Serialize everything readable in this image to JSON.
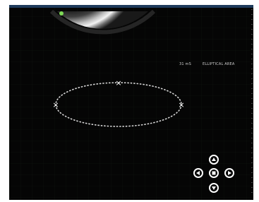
{
  "viewer": {
    "background_color": "#050505",
    "top_bar_color": "#1f3b5c",
    "grid_color": "#2b3a2b",
    "probe_indicator_color": "#7ed957"
  },
  "measurement": {
    "value_text": "31 mS",
    "label_text": "ELLIPTICAL AREA"
  },
  "ellipse_markers": {
    "marker_glyph": "×",
    "top": "×",
    "left": "×",
    "right": "×"
  },
  "navigation": {
    "up_icon": "arrow-up-icon",
    "left_icon": "arrow-left-icon",
    "center_icon": "stop-square-icon",
    "right_icon": "arrow-right-icon",
    "down_icon": "arrow-down-icon"
  }
}
